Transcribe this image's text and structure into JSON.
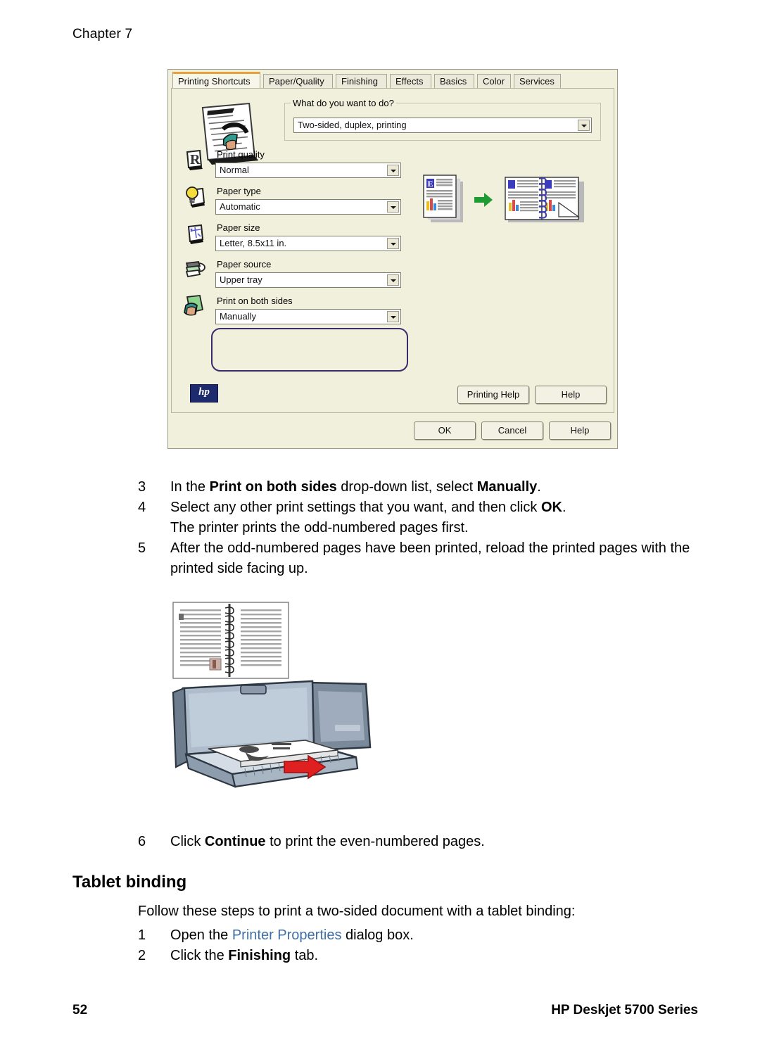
{
  "page": {
    "chapter": "Chapter 7",
    "number": "52",
    "product": "HP Deskjet 5700 Series"
  },
  "dialog": {
    "tabs": [
      {
        "label": "Printing Shortcuts",
        "active": true
      },
      {
        "label": "Paper/Quality",
        "active": false
      },
      {
        "label": "Finishing",
        "active": false
      },
      {
        "label": "Effects",
        "active": false
      },
      {
        "label": "Basics",
        "active": false
      },
      {
        "label": "Color",
        "active": false
      },
      {
        "label": "Services",
        "active": false
      }
    ],
    "what_group": {
      "title": "What do you want to do?",
      "value": "Two-sided, duplex, printing"
    },
    "fields": [
      {
        "label": "Print quality",
        "value": "Normal",
        "icon": "print-quality-icon"
      },
      {
        "label": "Paper type",
        "value": "Automatic",
        "icon": "lightbulb-icon"
      },
      {
        "label": "Paper size",
        "value": "Letter, 8.5x11 in.",
        "icon": "ruler-icon"
      },
      {
        "label": "Paper source",
        "value": "Upper tray",
        "icon": "paper-stack-icon"
      },
      {
        "label": "Print on both sides",
        "value": "Manually",
        "icon": "both-sides-icon"
      }
    ],
    "logo_text": "hp",
    "help_buttons": [
      {
        "label": "Printing Help"
      },
      {
        "label": "Help"
      }
    ],
    "footer_buttons": [
      {
        "label": "OK"
      },
      {
        "label": "Cancel"
      },
      {
        "label": "Help"
      }
    ],
    "colors": {
      "background": "#f1f0dd",
      "active_tab_accent": "#e8a13a",
      "highlight_outline": "#3c2a6b",
      "hp_logo": "#1e2a6e",
      "preview_arrow": "#1e9b32"
    }
  },
  "steps_top": [
    {
      "num": "3",
      "parts": [
        {
          "t": "In the ",
          "b": false
        },
        {
          "t": "Print on both sides",
          "b": true
        },
        {
          "t": " drop-down list, select ",
          "b": false
        },
        {
          "t": "Manually",
          "b": true
        },
        {
          "t": ".",
          "b": false
        }
      ]
    },
    {
      "num": "4",
      "parts": [
        {
          "t": "Select any other print settings that you want, and then click ",
          "b": false
        },
        {
          "t": "OK",
          "b": true
        },
        {
          "t": ".",
          "b": false
        }
      ],
      "sub": "The printer prints the odd-numbered pages first."
    },
    {
      "num": "5",
      "parts": [
        {
          "t": "After the odd-numbered pages have been printed, reload the printed pages with the printed side facing up.",
          "b": false
        }
      ]
    }
  ],
  "step_six": {
    "num": "6",
    "parts": [
      {
        "t": "Click ",
        "b": false
      },
      {
        "t": "Continue",
        "b": true
      },
      {
        "t": " to print the even-numbered pages.",
        "b": false
      }
    ]
  },
  "tablet_section": {
    "heading": "Tablet binding",
    "intro": "Follow these steps to print a two-sided document with a tablet binding:",
    "steps": [
      {
        "num": "1",
        "parts": [
          {
            "t": "Open the ",
            "b": false
          },
          {
            "t": "Printer Properties",
            "b": false,
            "link": true
          },
          {
            "t": " dialog box.",
            "b": false
          }
        ]
      },
      {
        "num": "2",
        "parts": [
          {
            "t": "Click the ",
            "b": false
          },
          {
            "t": "Finishing",
            "b": true
          },
          {
            "t": " tab.",
            "b": false
          }
        ]
      }
    ]
  }
}
